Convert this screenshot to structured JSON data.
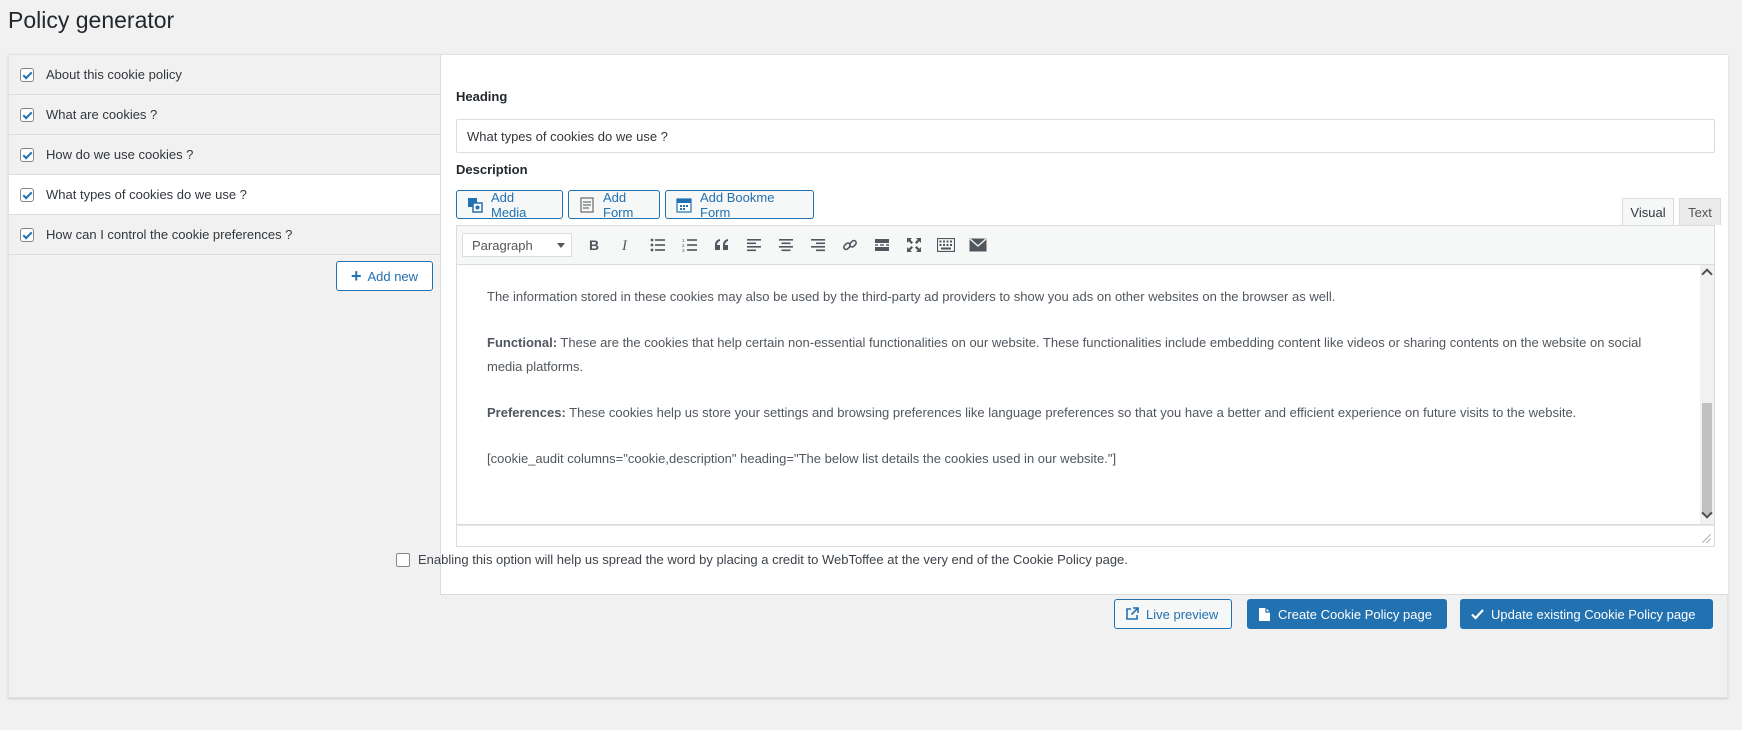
{
  "page": {
    "title": "Policy generator"
  },
  "sidebar": {
    "items": [
      {
        "label": "About this cookie policy",
        "checked": true,
        "active": false
      },
      {
        "label": "What are cookies ?",
        "checked": true,
        "active": false
      },
      {
        "label": "How do we use cookies ?",
        "checked": true,
        "active": false
      },
      {
        "label": "What types of cookies do we use ?",
        "checked": true,
        "active": true
      },
      {
        "label": "How can I control the cookie preferences ?",
        "checked": true,
        "active": false
      }
    ],
    "add_new_label": "Add new"
  },
  "editor": {
    "heading_label": "Heading",
    "heading_value": "What types of cookies do we use ?",
    "description_label": "Description",
    "media_buttons": {
      "add_media": "Add Media",
      "add_form": "Add Form",
      "add_bookme_form": "Add Bookme Form"
    },
    "tabs": {
      "visual": "Visual",
      "text": "Text",
      "active": "visual"
    },
    "format_select": "Paragraph",
    "content": {
      "p1": "The information stored in these cookies may also be used by the third-party ad providers to show you ads on other websites on the browser as well.",
      "p2_bold": "Functional:",
      "p2_text": " These are the cookies that help certain non-essential functionalities on our website. These functionalities include embedding content like videos or sharing contents on the website on social media platforms.",
      "p3_bold": "Preferences:",
      "p3_text": " These cookies help us store your settings and browsing preferences like language preferences so that you have a better and efficient experience on future visits to the website.",
      "p4": "[cookie_audit columns=\"cookie,description\" heading=\"The below list details the cookies used in our website.\"]"
    }
  },
  "credit": {
    "checked": false,
    "label": "Enabling this option will help us spread the word by placing a credit to WebToffee at the very end of the Cookie Policy page."
  },
  "actions": {
    "live_preview": "Live preview",
    "create_page": "Create Cookie Policy page",
    "update_page": "Update existing Cookie Policy page"
  },
  "colors": {
    "accent": "#2271b1",
    "background": "#f1f1f1",
    "panel": "#ffffff"
  }
}
